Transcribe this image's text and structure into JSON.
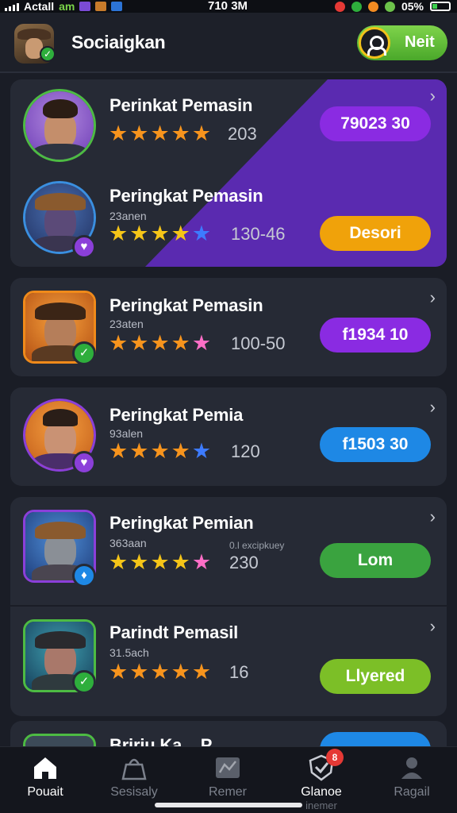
{
  "status_bar": {
    "carrier": "Actall",
    "network": "am",
    "time": "710 3M",
    "battery": "05%"
  },
  "header": {
    "title": "Sociaigkan",
    "action_label": "Neit",
    "avatar_icon": "cowboy-avatar",
    "action_icon": "user-icon"
  },
  "list": [
    {
      "name": "Perinkat Pemasin",
      "subtitle": "",
      "rating": 5,
      "stars": [
        "orange",
        "orange",
        "orange",
        "orange",
        "orange"
      ],
      "count": "203",
      "pill_label": "79023 30",
      "pill_color": "#8a2be2"
    },
    {
      "name": "Peringkat Pemasin",
      "subtitle": "23anen",
      "rating": 5,
      "stars": [
        "yellow",
        "yellow",
        "yellow",
        "yellow",
        "blue"
      ],
      "count": "130-46",
      "pill_label": "Desori",
      "pill_color": "#f0a20a"
    },
    {
      "name": "Peringkat Pemasin",
      "subtitle": "23aten",
      "rating": 5,
      "stars": [
        "orange",
        "orange",
        "orange",
        "orange",
        "pink"
      ],
      "count": "100-50",
      "pill_label": "f1934 10",
      "pill_color": "#8a2be2"
    },
    {
      "name": "Peringkat Pemia",
      "subtitle": "93alen",
      "rating": 5,
      "stars": [
        "orange",
        "orange",
        "orange",
        "orange",
        "blue"
      ],
      "count": "120",
      "pill_label": "f1503 30",
      "pill_color": "#1e88e5"
    },
    {
      "name": "Peringkat Pemian",
      "subtitle": "363aan",
      "note": "0.l excipkuey",
      "rating": 5,
      "stars": [
        "yellow",
        "yellow",
        "yellow",
        "yellow",
        "pink"
      ],
      "count": "230",
      "pill_label": "Lom",
      "pill_color": "#3aa33f"
    },
    {
      "name": "Parindt Pemasil",
      "subtitle": "31.5ach",
      "rating": 5,
      "stars": [
        "orange",
        "orange",
        "orange",
        "orange",
        "orange"
      ],
      "count": "16",
      "pill_label": "Llyered",
      "pill_color": "#7cbf27"
    },
    {
      "name": "Bririu Ka... P...",
      "subtitle": "",
      "rating": 0,
      "stars": [],
      "count": "",
      "pill_label": "",
      "pill_color": "#1e88e5"
    }
  ],
  "nav": [
    {
      "label": "Pouait",
      "icon": "home-icon",
      "active": true
    },
    {
      "label": "Sesisaly",
      "icon": "bag-icon",
      "active": false
    },
    {
      "label": "Remer",
      "icon": "map-icon",
      "active": false
    },
    {
      "label": "Glanoe",
      "sub": "inemer",
      "icon": "shield-icon",
      "badge": "8",
      "active": true
    },
    {
      "label": "Ragail",
      "icon": "profile-icon",
      "active": false
    }
  ],
  "colors": {
    "orange_star": "#f7941d",
    "yellow_star": "#f5c518",
    "blue_star": "#3d7bff",
    "pink_star": "#ff6ec7",
    "accent_purple": "#5a2ab0"
  }
}
